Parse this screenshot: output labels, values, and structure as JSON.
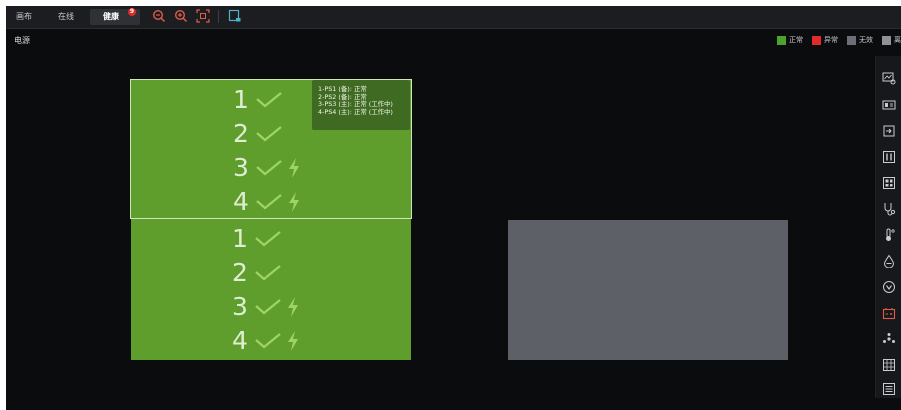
{
  "tabs": [
    {
      "label": "画布",
      "active": false
    },
    {
      "label": "在线",
      "active": false
    },
    {
      "label": "健康",
      "active": true,
      "badge": "9"
    }
  ],
  "toolbar_icons": [
    "zoom-out-icon",
    "zoom-in-icon",
    "fit-screen-icon",
    "export-icon"
  ],
  "section": {
    "title": "电源"
  },
  "legend": [
    {
      "label": "正常",
      "color": "#4aa32c"
    },
    {
      "label": "异常",
      "color": "#e02b2b"
    },
    {
      "label": "无效",
      "color": "#6c7076"
    },
    {
      "label": "离",
      "color": "#8e9196"
    }
  ],
  "panels": [
    {
      "psus": [
        {
          "num": "1",
          "bolt": false
        },
        {
          "num": "2",
          "bolt": false
        },
        {
          "num": "3",
          "bolt": true
        },
        {
          "num": "4",
          "bolt": true
        }
      ]
    },
    {
      "psus": [
        {
          "num": "1",
          "bolt": false
        },
        {
          "num": "2",
          "bolt": false
        },
        {
          "num": "3",
          "bolt": true
        },
        {
          "num": "4",
          "bolt": true
        }
      ]
    }
  ],
  "tooltip": {
    "lines": [
      "1-PS1 (备): 正常",
      "2-PS2 (备): 正常",
      "3-PS3 (主): 正常 (工作中)",
      "4-PS4 (主): 正常 (工作中)"
    ]
  },
  "colors": {
    "panel_green": "#5f9e2d",
    "panel_gray": "#5d6167",
    "accent_red": "#e05a4a"
  },
  "sidebar_icons": [
    "chart-settings-icon",
    "card-icon",
    "login-icon",
    "ports-icon",
    "grid-icon",
    "stethoscope-icon",
    "temperature-icon",
    "water-drop-icon",
    "down-circle-icon",
    "battery-icon",
    "fan-icon",
    "keypad-icon",
    "list-icon"
  ]
}
